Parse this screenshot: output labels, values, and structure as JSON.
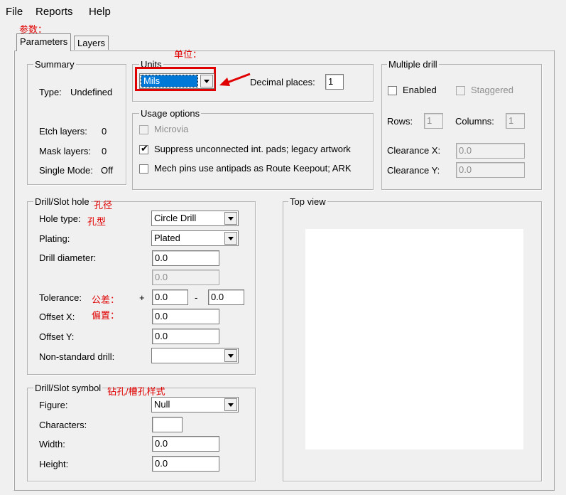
{
  "menu": {
    "file": "File",
    "reports": "Reports",
    "help": "Help"
  },
  "annotations": {
    "params": "参数：",
    "units": "单位：",
    "hole": "孔径",
    "hole_type": "孔型",
    "tolerance": "公差：",
    "offset": "偏置：",
    "symbol": "钻孔/槽孔样式"
  },
  "tabs": [
    "Parameters",
    "Layers"
  ],
  "summary": {
    "title": "Summary",
    "type_label": "Type:",
    "type_value": "Undefined",
    "etch_label": "Etch layers:",
    "etch_value": "0",
    "mask_label": "Mask layers:",
    "mask_value": "0",
    "single_label": "Single Mode:",
    "single_value": "Off"
  },
  "units": {
    "title": "Units",
    "selected": "Mils",
    "decimal_label": "Decimal places:",
    "decimal_value": "1"
  },
  "usage": {
    "title": "Usage options",
    "microvia": "Microvia",
    "suppress": "Suppress unconnected int. pads; legacy artwork",
    "mech": "Mech pins use antipads as Route Keepout; ARK"
  },
  "multi": {
    "title": "Multiple drill",
    "enabled": "Enabled",
    "staggered": "Staggered",
    "rows_label": "Rows:",
    "rows_value": "1",
    "cols_label": "Columns:",
    "cols_value": "1",
    "clrx_label": "Clearance X:",
    "clrx_value": "0.0",
    "clry_label": "Clearance Y:",
    "clry_value": "0.0"
  },
  "drill": {
    "title": "Drill/Slot hole",
    "hole_type_label": "Hole type:",
    "hole_type_value": "Circle Drill",
    "plating_label": "Plating:",
    "plating_value": "Plated",
    "diameter_label": "Drill diameter:",
    "diameter_value": "0.0",
    "diameter2_value": "0.0",
    "tolerance_label": "Tolerance:",
    "plus": "+",
    "tol_plus": "0.0",
    "minus": "-",
    "tol_minus": "0.0",
    "offx_label": "Offset X:",
    "offx_value": "0.0",
    "offy_label": "Offset Y:",
    "offy_value": "0.0",
    "nonstd_label": "Non-standard drill:",
    "nonstd_value": ""
  },
  "symbol": {
    "title": "Drill/Slot symbol",
    "figure_label": "Figure:",
    "figure_value": "Null",
    "chars_label": "Characters:",
    "chars_value": "",
    "width_label": "Width:",
    "width_value": "0.0",
    "height_label": "Height:",
    "height_value": "0.0"
  },
  "topview": {
    "title": "Top view"
  },
  "colors": {
    "highlight": "#0078d7",
    "annotation": "#e00000"
  }
}
